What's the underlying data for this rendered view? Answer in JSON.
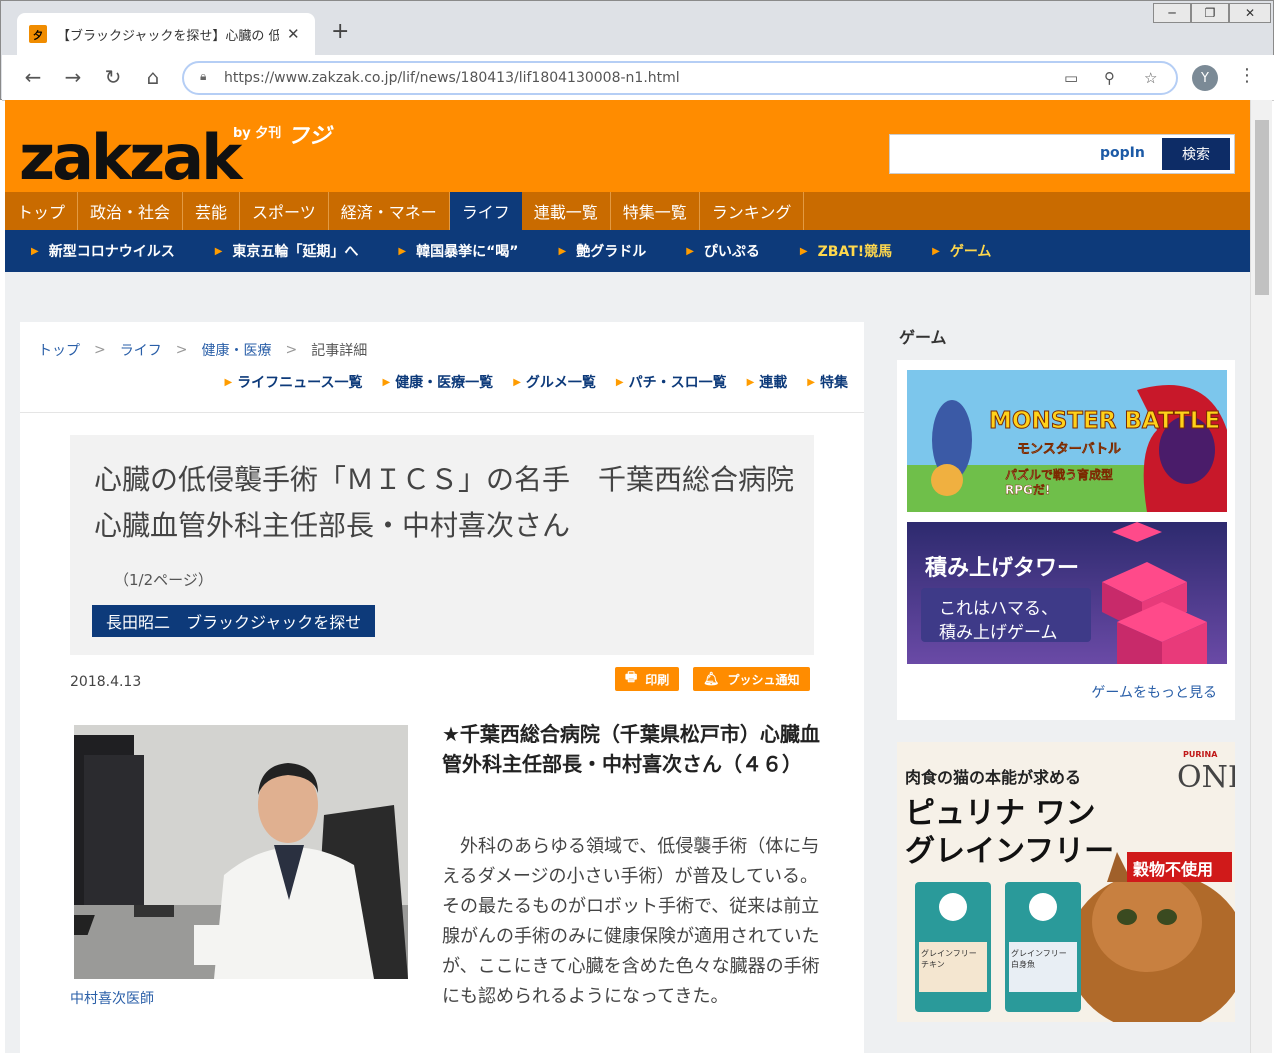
{
  "browser": {
    "tab_title": "【ブラックジャックを探せ】心臓の 低侵襲",
    "favicon_glyph": "夕",
    "url": "https://www.zakzak.co.jp/lif/news/180413/lif1804130008-n1.html",
    "avatar_letter": "Y"
  },
  "site": {
    "logo": "zakzak",
    "logo_by": "by 夕刊",
    "logo_fuji": "フジ",
    "popin": "popIn",
    "search_button": "検索",
    "brand_orange": "#ff8c00",
    "brand_navy": "#0d3a7a"
  },
  "main_nav": [
    {
      "label": "トップ",
      "active": false
    },
    {
      "label": "政治・社会",
      "active": false
    },
    {
      "label": "芸能",
      "active": false
    },
    {
      "label": "スポーツ",
      "active": false
    },
    {
      "label": "経済・マネー",
      "active": false
    },
    {
      "label": "ライフ",
      "active": true
    },
    {
      "label": "連載一覧",
      "active": false
    },
    {
      "label": "特集一覧",
      "active": false
    },
    {
      "label": "ランキング",
      "active": false
    }
  ],
  "sub_nav": [
    {
      "label": "新型コロナウイルス",
      "yellow": false
    },
    {
      "label": "東京五輪「延期」へ",
      "yellow": false
    },
    {
      "label": "韓国暴挙に“喝”",
      "yellow": false
    },
    {
      "label": "艶グラドル",
      "yellow": false
    },
    {
      "label": "ぴいぷる",
      "yellow": false
    },
    {
      "label": "ZBAT!競馬",
      "yellow": true
    },
    {
      "label": "ゲーム",
      "yellow": true
    }
  ],
  "breadcrumb": [
    "トップ",
    "ライフ",
    "健康・医療",
    "記事詳細"
  ],
  "category_links": [
    "ライフニュース一覧",
    "健康・医療一覧",
    "グルメ一覧",
    "パチ・スロ一覧",
    "連載",
    "特集"
  ],
  "article": {
    "title": "心臓の低侵襲手術「ＭＩＣＳ」の名手　千葉西総合病院　心臓血管外科主任部長・中村喜次さん",
    "page_no": "（1/2ページ）",
    "series": "長田昭二　ブラックジャックを探せ",
    "date": "2018.4.13",
    "print_label": "印刷",
    "push_label": "プッシュ通知",
    "photo_caption": "中村喜次医師",
    "lead": "★千葉西総合病院（千葉県松戸市）心臓血管外科主任部長・中村喜次さん（４６）",
    "body": "外科のあらゆる領域で、低侵襲手術（体に与えるダメージの小さい手術）が普及している。その最たるものがロボット手術で、従来は前立腺がんの手術のみに健康保険が適用されていたが、ここにきて心臓を含めた色々な臓器の手術にも認められるようになってきた。"
  },
  "sidebar": {
    "title": "ゲーム",
    "game1_title": "MONSTER BATTLE",
    "game1_sub": "モンスターバトル",
    "game1_tag": "パズルで戦う育成型RPGだ!",
    "game2_title": "積み上げタワー",
    "game2_line1": "これはハマる、",
    "game2_line2": "積み上げゲーム",
    "more_link": "ゲームをもっと見る"
  },
  "ad": {
    "brand": "PURINA",
    "product": "ONE",
    "headline": "肉食の猫の本能が求める",
    "title_line1": "ピュリナ ワン",
    "title_line2": "グレインフリー",
    "badge": "穀物不使用",
    "bag1_label": "グレインフリー チキン",
    "bag2_label": "グレインフリー 白身魚"
  }
}
